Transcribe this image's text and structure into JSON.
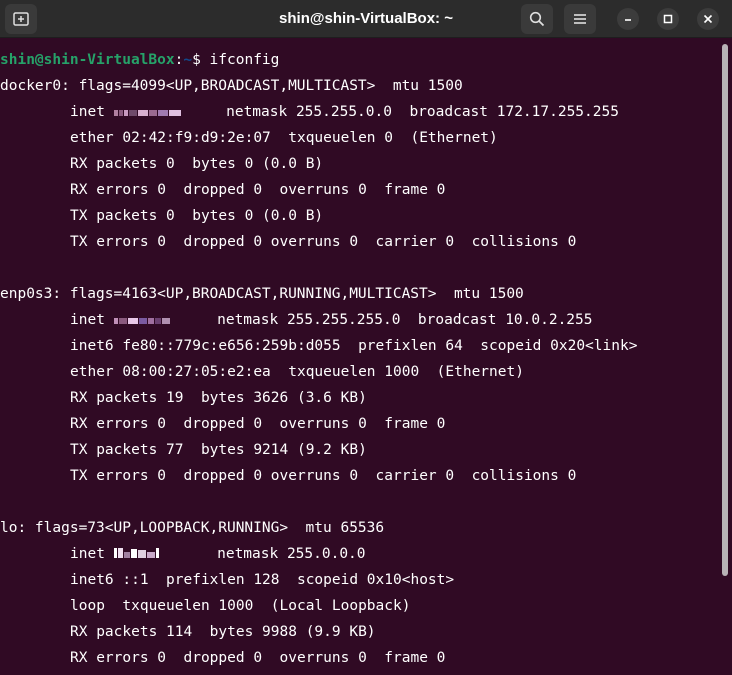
{
  "window": {
    "title": "shin@shin-VirtualBox: ~"
  },
  "prompt": {
    "user": "shin@shin-VirtualBox",
    "sep": ":",
    "path": "~",
    "symbol": "$ ",
    "command": "ifconfig"
  },
  "docker0": {
    "header": "docker0: flags=4099<UP,BROADCAST,MULTICAST>  mtu 1500",
    "inet_label": "inet ",
    "inet_rest": "  netmask 255.255.0.0  broadcast 172.17.255.255",
    "ether": "ether 02:42:f9:d9:2e:07  txqueuelen 0  (Ethernet)",
    "rx_packets": "RX packets 0  bytes 0 (0.0 B)",
    "rx_errors": "RX errors 0  dropped 0  overruns 0  frame 0",
    "tx_packets": "TX packets 0  bytes 0 (0.0 B)",
    "tx_errors": "TX errors 0  dropped 0 overruns 0  carrier 0  collisions 0"
  },
  "enp0s3": {
    "header": "enp0s3: flags=4163<UP,BROADCAST,RUNNING,MULTICAST>  mtu 1500",
    "inet_label": "inet ",
    "inet_rest": "  netmask 255.255.255.0  broadcast 10.0.2.255",
    "inet6": "inet6 fe80::779c:e656:259b:d055  prefixlen 64  scopeid 0x20<link>",
    "ether": "ether 08:00:27:05:e2:ea  txqueuelen 1000  (Ethernet)",
    "rx_packets": "RX packets 19  bytes 3626 (3.6 KB)",
    "rx_errors": "RX errors 0  dropped 0  overruns 0  frame 0",
    "tx_packets": "TX packets 77  bytes 9214 (9.2 KB)",
    "tx_errors": "TX errors 0  dropped 0 overruns 0  carrier 0  collisions 0"
  },
  "lo": {
    "header": "lo: flags=73<UP,LOOPBACK,RUNNING>  mtu 65536",
    "inet_label": "inet ",
    "inet_rest": "  netmask 255.0.0.0",
    "inet6": "inet6 ::1  prefixlen 128  scopeid 0x10<host>",
    "loop": "loop  txqueuelen 1000  (Local Loopback)",
    "rx_packets": "RX packets 114  bytes 9988 (9.9 KB)",
    "rx_errors": "RX errors 0  dropped 0  overruns 0  frame 0"
  },
  "icons": {
    "new_tab": "new-tab-icon",
    "search": "search-icon",
    "menu": "hamburger-menu-icon",
    "minimize": "minimize-icon",
    "maximize": "maximize-icon",
    "close": "close-icon"
  },
  "colors": {
    "background": "#300a24",
    "prompt_user": "#26a269",
    "prompt_path": "#12488b",
    "titlebar": "#2c2c2c"
  }
}
